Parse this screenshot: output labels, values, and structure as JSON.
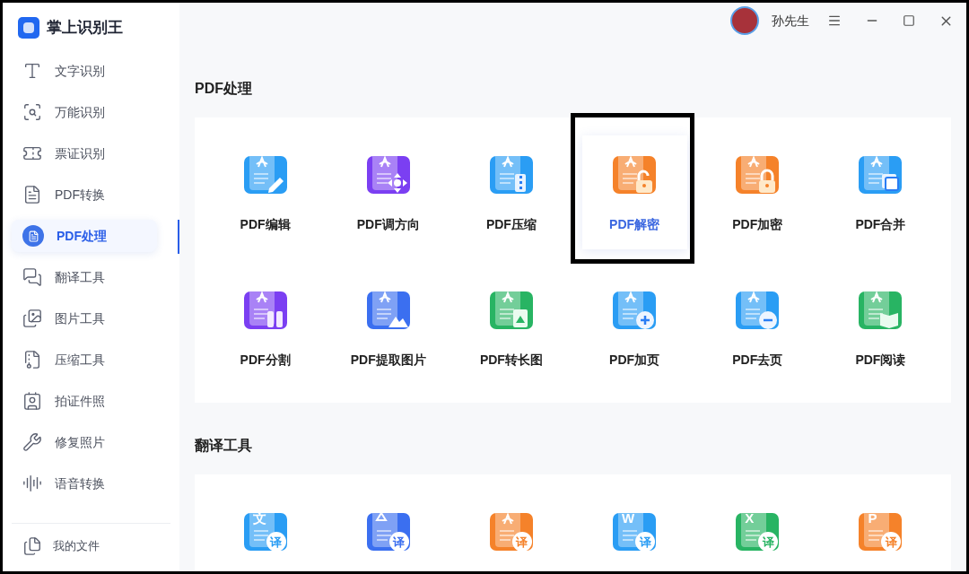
{
  "app": {
    "title": "掌上识别王"
  },
  "sidebar": {
    "items": [
      {
        "label": "文字识别",
        "selected": false
      },
      {
        "label": "万能识别",
        "selected": false
      },
      {
        "label": "票证识别",
        "selected": false
      },
      {
        "label": "PDF转换",
        "selected": false
      },
      {
        "label": "PDF处理",
        "selected": true
      },
      {
        "label": "翻译工具",
        "selected": false
      },
      {
        "label": "图片工具",
        "selected": false
      },
      {
        "label": "压缩工具",
        "selected": false
      },
      {
        "label": "拍证件照",
        "selected": false
      },
      {
        "label": "修复照片",
        "selected": false
      },
      {
        "label": "语音转换",
        "selected": false
      }
    ],
    "footer": {
      "label": "我的文件"
    }
  },
  "user": {
    "name": "孙先生"
  },
  "sections": [
    {
      "title": "PDF处理",
      "tools": [
        {
          "label": "PDF编辑",
          "kind": "pencil",
          "color": "#2a9df4",
          "selected": false,
          "outlined": false
        },
        {
          "label": "PDF调方向",
          "kind": "arrows",
          "color": "#7b3ff2",
          "selected": false,
          "outlined": false
        },
        {
          "label": "PDF压缩",
          "kind": "zip",
          "color": "#2a9df4",
          "selected": false,
          "outlined": false
        },
        {
          "label": "PDF解密",
          "kind": "unlock",
          "color": "#f5822a",
          "selected": true,
          "outlined": true
        },
        {
          "label": "PDF加密",
          "kind": "lock",
          "color": "#f5822a",
          "selected": false,
          "outlined": false
        },
        {
          "label": "PDF合并",
          "kind": "merge",
          "color": "#2a9df4",
          "selected": false,
          "outlined": false
        },
        {
          "label": "PDF分割",
          "kind": "split",
          "color": "#7b3ff2",
          "selected": false,
          "outlined": false
        },
        {
          "label": "PDF提取图片",
          "kind": "picture",
          "color": "#3b6ff0",
          "selected": false,
          "outlined": false
        },
        {
          "label": "PDF转长图",
          "kind": "longimage",
          "color": "#28b463",
          "selected": false,
          "outlined": false
        },
        {
          "label": "PDF加页",
          "kind": "plus",
          "color": "#2a9df4",
          "selected": false,
          "outlined": false
        },
        {
          "label": "PDF去页",
          "kind": "minus",
          "color": "#2a9df4",
          "selected": false,
          "outlined": false
        },
        {
          "label": "PDF阅读",
          "kind": "book",
          "color": "#28b463",
          "selected": false,
          "outlined": false
        }
      ]
    },
    {
      "title": "翻译工具",
      "tools": [
        {
          "kind": "letter",
          "letter": "文",
          "badge": "译",
          "color": "#2a9df4",
          "selected": false,
          "outlined": false
        },
        {
          "kind": "picture",
          "badge": "译",
          "color": "#3b6ff0",
          "selected": false,
          "outlined": false
        },
        {
          "kind": "pdf",
          "badge": "译",
          "color": "#f5822a",
          "selected": false,
          "outlined": false
        },
        {
          "kind": "letter",
          "letter": "W",
          "badge": "译",
          "color": "#2a9df4",
          "selected": false,
          "outlined": false
        },
        {
          "kind": "letter",
          "letter": "X",
          "badge": "译",
          "color": "#28b463",
          "selected": false,
          "outlined": false
        },
        {
          "kind": "letter",
          "letter": "P",
          "badge": "译",
          "color": "#f5822a",
          "selected": false,
          "outlined": false
        }
      ]
    }
  ]
}
